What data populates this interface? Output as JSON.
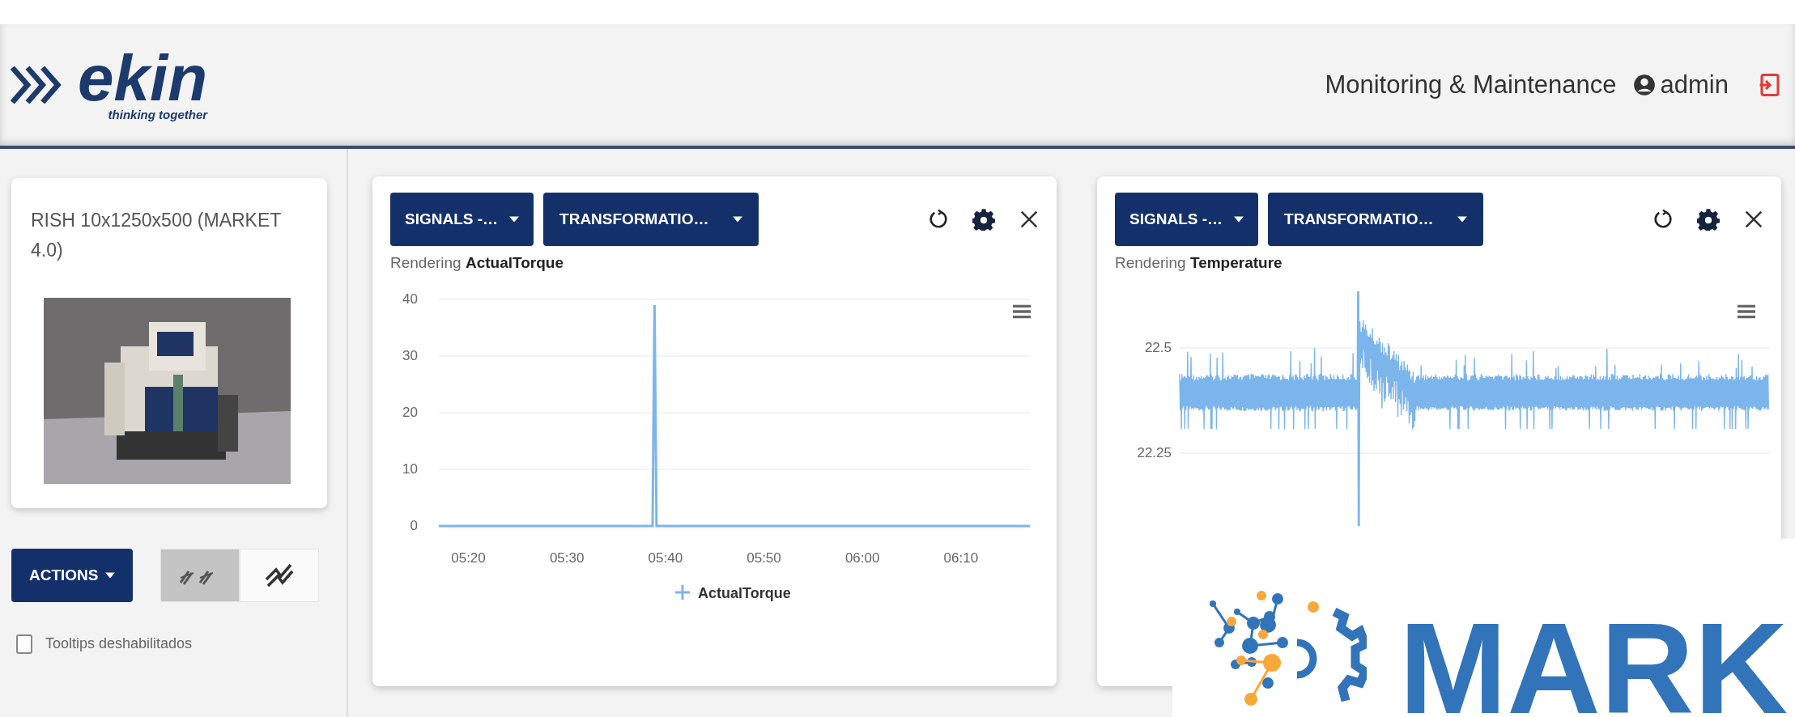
{
  "header": {
    "logo": {
      "name": "ekin",
      "tagline": "thinking together"
    },
    "title": "Monitoring & Maintenance",
    "user": "admin"
  },
  "sidebar": {
    "machine_card": {
      "title": "RISH 10x1250x500 (MARKET 4.0)"
    },
    "actions_button": "ACTIONS",
    "view_toggle": [
      {
        "kind": "split",
        "selected": true
      },
      {
        "kind": "combined",
        "selected": false
      }
    ],
    "tooltips": {
      "label": "Tooltips deshabilitados",
      "checked": false
    }
  },
  "panels": [
    {
      "kind": "chart",
      "signals_dropdown": "SIGNALS -…",
      "transformations_dropdown": "TRANSFORMATIO…",
      "rendering": "Rendering **ActualTorque**",
      "chart_data": {
        "type": "line",
        "grid": true,
        "x": [
          317,
          338.7,
          338.9,
          339.1,
          377
        ],
        "series": [
          {
            "name": "ActualTorque",
            "color": "#7cb5ec",
            "values": [
              0,
              0,
              39,
              0,
              0
            ]
          }
        ],
        "xlim": [
          317,
          377
        ],
        "ylim": [
          0,
          40
        ],
        "yticks": [
          0,
          10,
          20,
          30,
          40
        ],
        "xticks": [
          {
            "value": 320,
            "label": "05:20"
          },
          {
            "value": 330,
            "label": "05:30"
          },
          {
            "value": 340,
            "label": "05:40"
          },
          {
            "value": 350,
            "label": "05:50"
          },
          {
            "value": 360,
            "label": "06:00"
          },
          {
            "value": 370,
            "label": "06:10"
          }
        ]
      }
    },
    {
      "kind": "waveform",
      "signals_dropdown": "SIGNALS -…",
      "transformations_dropdown": "TRANSFORMATIO…",
      "rendering": "Rendering **Temperature**",
      "y_tick_labels": [
        "22.5",
        "22.25"
      ]
    }
  ],
  "overlay_logo": {
    "text": "MARK"
  }
}
